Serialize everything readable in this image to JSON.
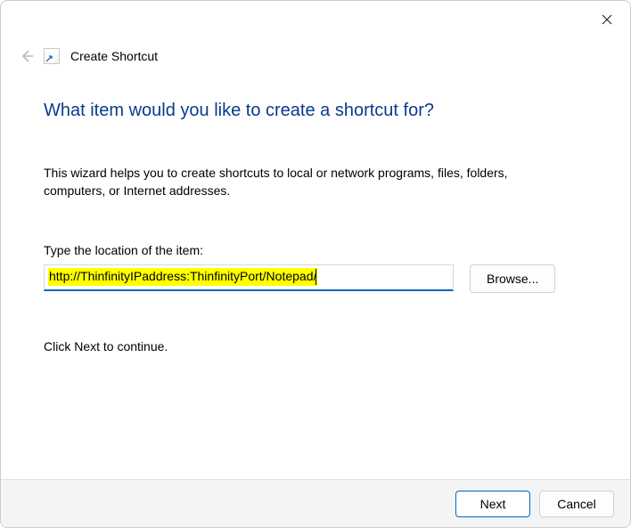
{
  "header": {
    "title": "Create Shortcut"
  },
  "main": {
    "heading": "What item would you like to create a shortcut for?",
    "description": "This wizard helps you to create shortcuts to local or network programs, files, folders, computers, or Internet addresses.",
    "location_label": "Type the location of the item:",
    "location_value": "http://ThinfinityIPaddress:ThinfinityPort/Notepad/",
    "browse_label": "Browse...",
    "continue_text": "Click Next to continue."
  },
  "footer": {
    "next_label": "Next",
    "cancel_label": "Cancel"
  }
}
